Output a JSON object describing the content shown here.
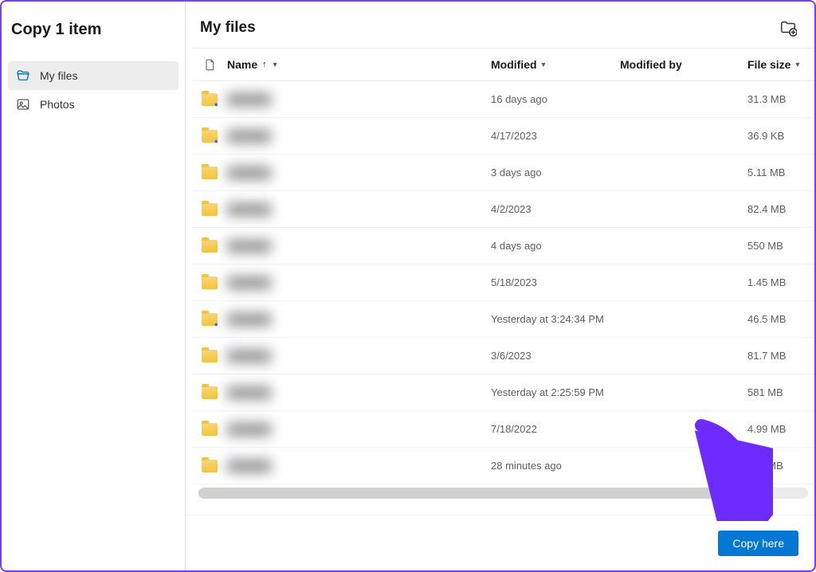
{
  "title": "Copy 1 item",
  "sidebar": {
    "items": [
      {
        "label": "My files",
        "icon": "folder-open"
      },
      {
        "label": "Photos",
        "icon": "photo"
      }
    ]
  },
  "breadcrumb": "My files",
  "columns": {
    "name": "Name",
    "modified": "Modified",
    "modified_by": "Modified by",
    "file_size": "File size"
  },
  "sort": {
    "column": "name",
    "direction": "asc"
  },
  "rows": [
    {
      "icon": "folder-person",
      "name": "",
      "modified": "16 days ago",
      "modified_by": "",
      "size": "31.3 MB"
    },
    {
      "icon": "folder-person",
      "name": "",
      "modified": "4/17/2023",
      "modified_by": "",
      "size": "36.9 KB"
    },
    {
      "icon": "folder",
      "name": "",
      "modified": "3 days ago",
      "modified_by": "",
      "size": "5.11 MB"
    },
    {
      "icon": "folder",
      "name": "",
      "modified": "4/2/2023",
      "modified_by": "",
      "size": "82.4 MB"
    },
    {
      "icon": "folder",
      "name": "",
      "modified": "4 days ago",
      "modified_by": "",
      "size": "550 MB"
    },
    {
      "icon": "folder",
      "name": "",
      "modified": "5/18/2023",
      "modified_by": "",
      "size": "1.45 MB"
    },
    {
      "icon": "folder-person",
      "name": "",
      "modified": "Yesterday at 3:24:34 PM",
      "modified_by": "",
      "size": "46.5 MB"
    },
    {
      "icon": "folder",
      "name": "",
      "modified": "3/6/2023",
      "modified_by": "",
      "size": "81.7 MB"
    },
    {
      "icon": "folder",
      "name": "",
      "modified": "Yesterday at 2:25:59 PM",
      "modified_by": "",
      "size": "581 MB"
    },
    {
      "icon": "folder",
      "name": "",
      "modified": "7/18/2022",
      "modified_by": "",
      "size": "4.99 MB"
    },
    {
      "icon": "folder",
      "name": "",
      "modified": "28 minutes ago",
      "modified_by": "",
      "size": "168 MB"
    }
  ],
  "primary_action": "Copy here",
  "annotation_arrow_color": "#6e2bff"
}
